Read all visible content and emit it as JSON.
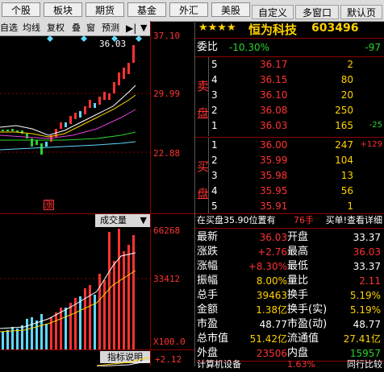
{
  "top_tabs": [
    "个股",
    "板块",
    "期货",
    "基金",
    "外汇",
    "美股"
  ],
  "right_tabs": [
    "自定义",
    "多窗口",
    "默认页"
  ],
  "chart_toolbar": [
    "自选",
    "均线",
    "复权",
    "叠",
    "窗",
    "预测"
  ],
  "stock": {
    "name": "恒为科技",
    "code": "603496",
    "stars": "★★★★"
  },
  "price_axis": {
    "top": "37.10",
    "mid": "29.99",
    "bottom": "22.88",
    "marker": "36.03"
  },
  "volume_axis": {
    "label": "成交量",
    "top": "66268",
    "mid": "33412",
    "bottom": "X100.0"
  },
  "indicator": {
    "label": "指标说明",
    "value": "+2.12"
  },
  "weibi": {
    "label": "委比",
    "pct": "-10.30%",
    "diff": "-97"
  },
  "sell_label": [
    "卖",
    "盘"
  ],
  "buy_label": [
    "买",
    "盘"
  ],
  "sell": [
    {
      "level": "5",
      "price": "36.17",
      "vol": "2",
      "chg": ""
    },
    {
      "level": "4",
      "price": "36.15",
      "vol": "80",
      "chg": ""
    },
    {
      "level": "3",
      "price": "36.10",
      "vol": "20",
      "chg": ""
    },
    {
      "level": "2",
      "price": "36.08",
      "vol": "250",
      "chg": ""
    },
    {
      "level": "1",
      "price": "36.03",
      "vol": "165",
      "chg": "-25"
    }
  ],
  "buy": [
    {
      "level": "1",
      "price": "36.00",
      "vol": "247",
      "chg": "+129"
    },
    {
      "level": "2",
      "price": "35.99",
      "vol": "104",
      "chg": ""
    },
    {
      "level": "3",
      "price": "35.98",
      "vol": "13",
      "chg": ""
    },
    {
      "level": "4",
      "price": "35.95",
      "vol": "56",
      "chg": ""
    },
    {
      "level": "5",
      "price": "35.91",
      "vol": "1",
      "chg": ""
    }
  ],
  "notice": {
    "text": "在买盘35.90位置有",
    "count": "76手",
    "link": "买单!查看详细"
  },
  "stats": [
    {
      "l1": "最新",
      "v1": "36.03",
      "c1": "red",
      "l2": "开盘",
      "v2": "33.37",
      "c2": "white"
    },
    {
      "l1": "涨跌",
      "v1": "+2.76",
      "c1": "red",
      "l2": "最高",
      "v2": "36.03",
      "c2": "red"
    },
    {
      "l1": "涨幅",
      "v1": "+8.30%",
      "c1": "red",
      "l2": "最低",
      "v2": "33.37",
      "c2": "white"
    },
    {
      "l1": "振幅",
      "v1": "8.00%",
      "c1": "yellow",
      "l2": "量比",
      "v2": "2.11",
      "c2": "red"
    },
    {
      "l1": "总手",
      "v1": "39463",
      "c1": "yellow",
      "l2": "换手",
      "v2": "5.19%",
      "c2": "yellow"
    },
    {
      "l1": "金额",
      "v1": "1.38亿",
      "c1": "yellow",
      "l2": "换手(实)",
      "v2": "5.19%",
      "c2": "yellow"
    },
    {
      "l1": "市盈",
      "v1": "48.77",
      "c1": "white",
      "l2": "市盈(动)",
      "v2": "48.77",
      "c2": "white"
    },
    {
      "l1": "总市值",
      "v1": "51.42亿",
      "c1": "yellow",
      "l2": "流通值",
      "v2": "27.41亿",
      "c2": "yellow"
    },
    {
      "l1": "外盘",
      "v1": "23506",
      "c1": "red",
      "l2": "内盘",
      "v2": "15957",
      "c2": "green"
    }
  ],
  "bottom_row": {
    "label": "计算机设备",
    "pct": "1.63%",
    "link": "同行比较"
  },
  "colors": {
    "up": "#ff3232",
    "down": "#2bd32b",
    "grid": "#8b0000",
    "text": "#ffffff"
  }
}
